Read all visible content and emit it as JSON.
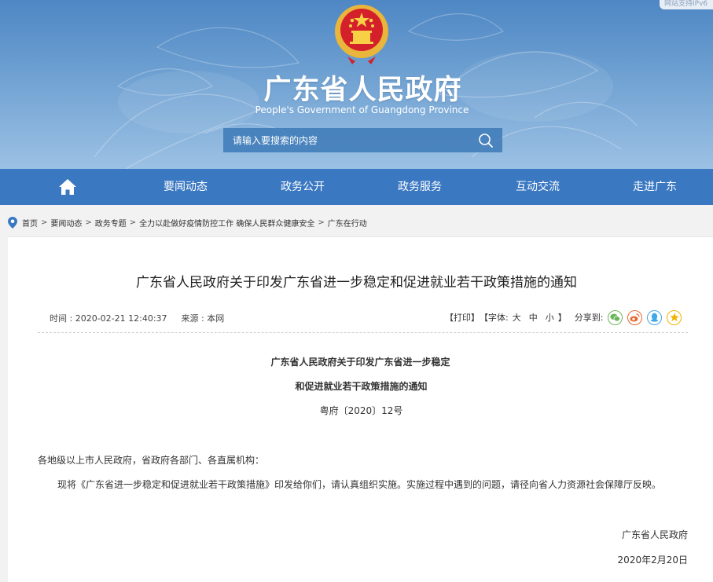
{
  "header": {
    "ipv6_badge": "网站支持IPv6",
    "title": "广东省人民政府",
    "subtitle": "People's Government of Guangdong Province",
    "search_placeholder": "请输入要搜索的内容"
  },
  "nav": {
    "items": [
      {
        "label": "要闻动态"
      },
      {
        "label": "政务公开"
      },
      {
        "label": "政务服务"
      },
      {
        "label": "互动交流"
      },
      {
        "label": "走进广东"
      }
    ]
  },
  "breadcrumb": {
    "items": [
      "首页",
      "要闻动态",
      "政务专题",
      "全力以赴做好疫情防控工作 确保人民群众健康安全",
      "广东在行动"
    ],
    "separator": ">"
  },
  "article": {
    "title": "广东省人民政府关于印发广东省进一步稳定和促进就业若干政策措施的通知",
    "time": "时间 : 2020-02-21 12:40:37",
    "source": "来源 : 本网",
    "print": "【打印】",
    "font_label": "【字体:",
    "font_large": "大",
    "font_medium": "中",
    "font_small": "小",
    "font_close": "】",
    "share_label": "分享到:",
    "doc_title_line1": "广东省人民政府关于印发广东省进一步稳定",
    "doc_title_line2": "和促进就业若干政策措施的通知",
    "doc_number": "粤府〔2020〕12号",
    "salutation": "各地级以上市人民政府，省政府各部门、各直属机构：",
    "body": "现将《广东省进一步稳定和促进就业若干政策措施》印发给你们，请认真组织实施。实施过程中遇到的问题，请径向省人力资源社会保障厅反映。",
    "signature": "广东省人民政府",
    "date": "2020年2月20日"
  },
  "colors": {
    "nav_bg": "#3a78c2",
    "wechat": "#6bb65a",
    "weibo": "#e8672f",
    "qq": "#3fa8e6",
    "qzone": "#f0b400"
  }
}
